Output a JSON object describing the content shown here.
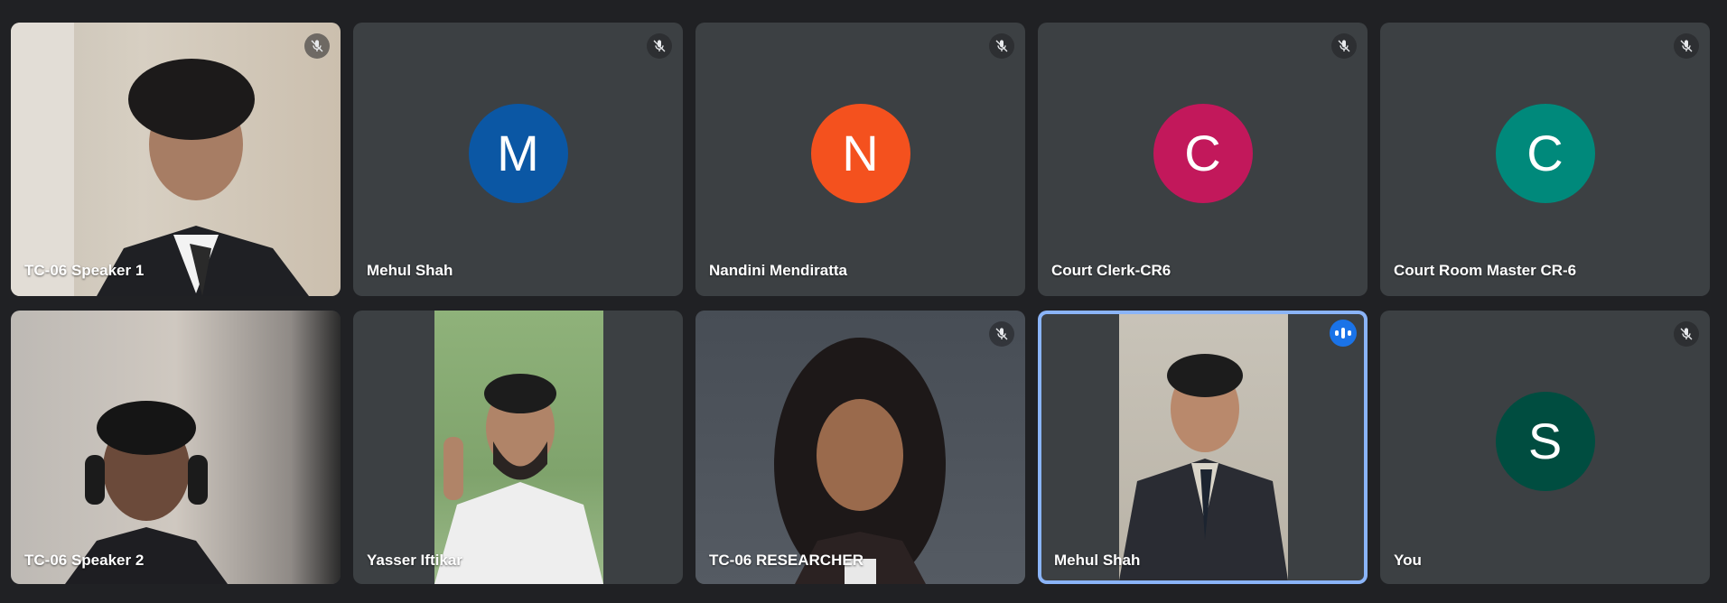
{
  "participants": [
    {
      "name": "TC-06 Speaker 1",
      "avatar": "",
      "avatar_color": "",
      "video": "webcam-1",
      "muted": true
    },
    {
      "name": "Mehul Shah",
      "avatar": "M",
      "avatar_color": "#0b57a4",
      "video": "",
      "muted": true
    },
    {
      "name": "Nandini Mendiratta",
      "avatar": "N",
      "avatar_color": "#f4511e",
      "video": "",
      "muted": true
    },
    {
      "name": "Court Clerk-CR6",
      "avatar": "C",
      "avatar_color": "#c2185b",
      "video": "",
      "muted": true
    },
    {
      "name": "Court Room Master CR-6",
      "avatar": "C",
      "avatar_color": "#00897b",
      "video": "",
      "muted": true
    },
    {
      "name": "TC-06 Speaker 2",
      "avatar": "",
      "avatar_color": "",
      "video": "webcam-2",
      "muted": false
    },
    {
      "name": "Yasser Iftikar",
      "avatar": "",
      "avatar_color": "",
      "video": "webcam-3",
      "muted": false
    },
    {
      "name": "TC-06 RESEARCHER",
      "avatar": "",
      "avatar_color": "",
      "video": "webcam-4",
      "muted": true
    },
    {
      "name": "Mehul Shah",
      "avatar": "",
      "avatar_color": "",
      "video": "webcam-5",
      "muted": false,
      "speaking": true
    },
    {
      "name": "You",
      "avatar": "S",
      "avatar_color": "#004d40",
      "video": "",
      "muted": true
    }
  ],
  "icons": {
    "mic_off": "mic-off-icon",
    "speaking": "audio-level-icon"
  },
  "colors": {
    "background": "#202124",
    "tile": "#3c4043",
    "active_speaker_border": "#8ab4f8",
    "speaking_badge": "#1a73e8"
  }
}
